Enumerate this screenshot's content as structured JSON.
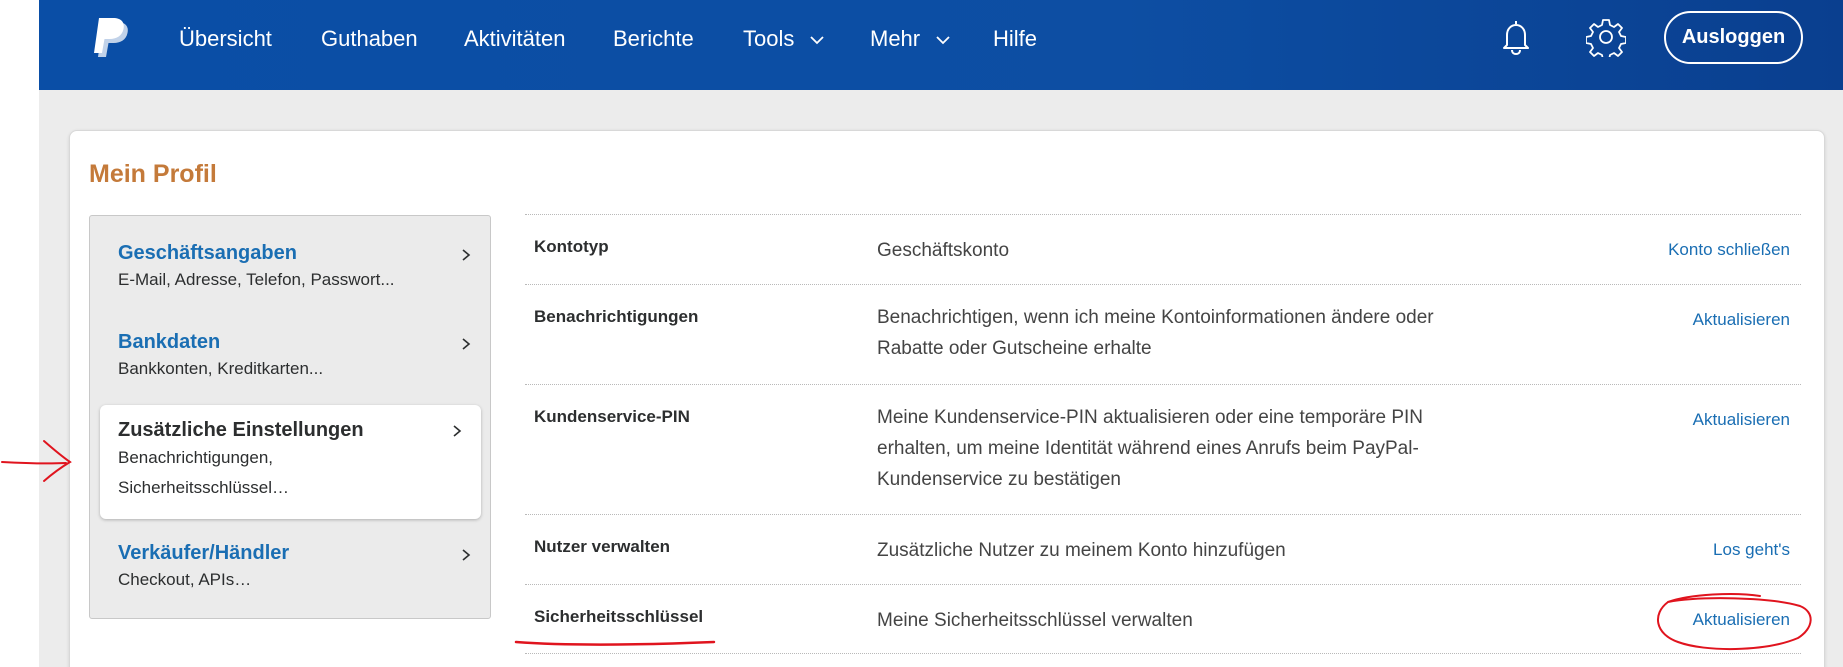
{
  "nav": {
    "items": [
      {
        "label": "Übersicht"
      },
      {
        "label": "Guthaben"
      },
      {
        "label": "Aktivitäten"
      },
      {
        "label": "Berichte"
      },
      {
        "label": "Tools"
      },
      {
        "label": "Mehr"
      },
      {
        "label": "Hilfe"
      }
    ],
    "logout_label": "Ausloggen",
    "icons": [
      "paypal-logo-icon",
      "bell-icon",
      "gear-icon",
      "chevron-down-icon"
    ]
  },
  "page": {
    "title": "Mein Profil"
  },
  "sidebar": {
    "items": [
      {
        "title": "Geschäftsangaben",
        "desc_line1": "E-Mail, Adresse, Telefon, Passwort...",
        "desc_line2": ""
      },
      {
        "title": "Bankdaten",
        "desc_line1": "Bankkonten, Kreditkarten...",
        "desc_line2": ""
      },
      {
        "title": "Zusätzliche Einstellungen",
        "desc_line1": "Benachrichtigungen,",
        "desc_line2": "Sicherheitsschlüssel…",
        "active": true
      },
      {
        "title": "Verkäufer/Händler",
        "desc_line1": "Checkout, APIs…",
        "desc_line2": ""
      }
    ]
  },
  "settings": {
    "rows": [
      {
        "label": "Kontotyp",
        "desc": "Geschäftskonto",
        "action": "Konto schließen"
      },
      {
        "label": "Benachrichtigungen",
        "desc": "Benachrichtigen, wenn ich meine Kontoinformationen ändere oder Rabatte oder Gutscheine erhalte",
        "action": "Aktualisieren"
      },
      {
        "label": "Kundenservice-PIN",
        "desc": "Meine Kundenservice-PIN aktualisieren oder eine temporäre PIN erhalten, um meine Identität während eines Anrufs beim PayPal-Kundenservice zu bestätigen",
        "action": "Aktualisieren"
      },
      {
        "label": "Nutzer verwalten",
        "desc": "Zusätzliche Nutzer zu meinem Konto hinzufügen",
        "action": "Los geht's"
      },
      {
        "label": "Sicherheitsschlüssel",
        "desc": "Meine Sicherheitsschlüssel verwalten",
        "action": "Aktualisieren"
      }
    ]
  },
  "colors": {
    "nav_bg": "#0a4ea6",
    "title_orange": "#c47a3a",
    "link_blue": "#1a6eb3",
    "annotation_red": "#e0141e"
  }
}
